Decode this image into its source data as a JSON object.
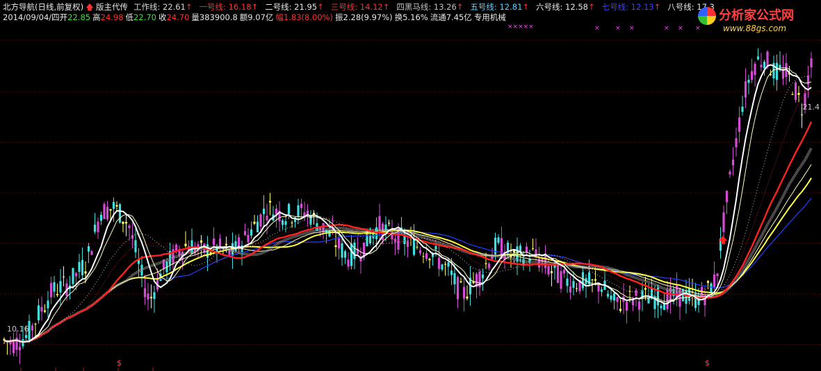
{
  "header": {
    "indicator": "北方导航(日线,前复权)",
    "up_arrow": "🡅",
    "subtitle": "版主代传",
    "lines": [
      {
        "label": "工作线:",
        "value": "22.61",
        "color": "#d8d8d8",
        "arrow": "↑"
      },
      {
        "label": "一号线:",
        "value": "16.18",
        "color": "#ff3030",
        "arrow": "↑"
      },
      {
        "label": "二号线:",
        "value": "21.95",
        "color": "#e8e8e8",
        "arrow": "↑"
      },
      {
        "label": "三号线:",
        "value": "14.12",
        "color": "#ff3030",
        "arrow": "↑"
      },
      {
        "label": "四黑马线:",
        "value": "13.26",
        "color": "#c0c0c0",
        "arrow": "↑"
      },
      {
        "label": "五号线:",
        "value": "12.81",
        "color": "#60d0ff",
        "arrow": "↑"
      },
      {
        "label": "六号线:",
        "value": "12.58",
        "color": "#e8e8e8",
        "arrow": "↑"
      },
      {
        "label": "七号线:",
        "value": "12.13",
        "color": "#4040ff",
        "arrow": "↑"
      },
      {
        "label": "八号线:",
        "value": "17.3",
        "color": "#e8e8e8",
        "arrow": ""
      }
    ]
  },
  "quote": {
    "date": "2014/09/04/四",
    "open_label": "开",
    "open": "22.85",
    "high_label": "高",
    "high": "24.98",
    "low_label": "低",
    "low": "22.70",
    "close_label": "收",
    "close": "24.70",
    "volume": "量383900.8",
    "amount": "额9.07亿",
    "change": "幅1.83(8.00%)",
    "amplitude": "振2.28(9.97%)",
    "turnover": "换5.16%",
    "float": "流通7.45亿",
    "sector": "专用机械"
  },
  "logo": {
    "title": "分析家公式网",
    "url": "www.88gs.com"
  },
  "labels": {
    "price_right": "21.4",
    "price_left": "10.16",
    "signal": "$",
    "marks": "×××××"
  },
  "colors": {
    "up_candle": "#d44cd4",
    "down_candle": "#40e0e0",
    "flat_candle": "#ffff60",
    "work_line": "#ffffff",
    "line1": "#ff2020",
    "line2": "#ffffc0",
    "line_yellow": "#ffff40",
    "line_blue": "#2040ff",
    "grid": "#7a1010"
  },
  "chart_data": {
    "type": "candlestick",
    "y_range": [
      9.5,
      26
    ],
    "last_close": 24.7,
    "ma_last": {
      "work": 22.61,
      "line1": 16.18,
      "line2": 21.95,
      "line3": 14.12,
      "line4": 13.26,
      "line5": 12.81,
      "line6": 12.58,
      "line7": 12.13,
      "line8": 17.3
    }
  }
}
